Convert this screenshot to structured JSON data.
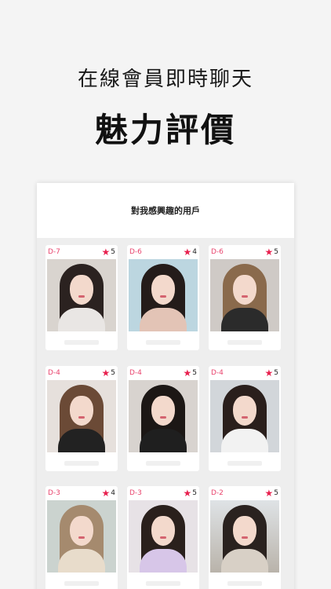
{
  "promo": {
    "subtitle": "在線會員即時聊天",
    "title": "魅力評價"
  },
  "screen": {
    "header_title": "對我感興趣的用戶"
  },
  "cards": [
    {
      "dday": "D-7",
      "rating": "5",
      "photo": "portrait-1"
    },
    {
      "dday": "D-6",
      "rating": "4",
      "photo": "portrait-2"
    },
    {
      "dday": "D-6",
      "rating": "5",
      "photo": "portrait-3"
    },
    {
      "dday": "D-4",
      "rating": "5",
      "photo": "portrait-4"
    },
    {
      "dday": "D-4",
      "rating": "5",
      "photo": "portrait-5"
    },
    {
      "dday": "D-4",
      "rating": "5",
      "photo": "portrait-6"
    },
    {
      "dday": "D-3",
      "rating": "4",
      "photo": "portrait-7"
    },
    {
      "dday": "D-3",
      "rating": "5",
      "photo": "portrait-8"
    },
    {
      "dday": "D-2",
      "rating": "5",
      "photo": "portrait-9"
    }
  ],
  "colors": {
    "accent": "#e8214f",
    "dday_text": "#e9456e",
    "page_bg": "#f4f4f4",
    "grid_bg": "#eeeeee"
  },
  "icons": {
    "rating": "star-icon"
  }
}
